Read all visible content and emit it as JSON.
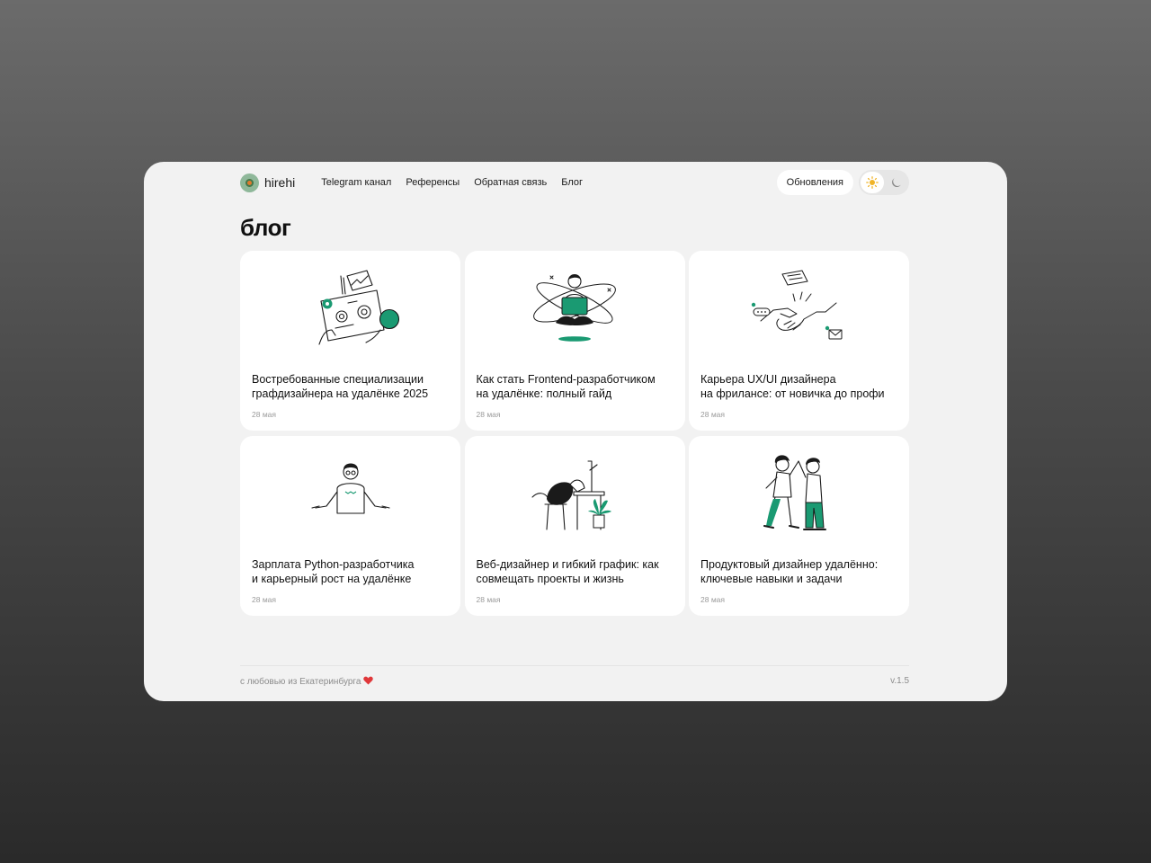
{
  "header": {
    "logo_text": "hirehi",
    "nav": [
      "Telegram канал",
      "Референсы",
      "Обратная связь",
      "Блог"
    ],
    "updates_label": "Обновления",
    "theme": {
      "active": "light",
      "light_icon": "sun-icon",
      "dark_icon": "moon-icon"
    }
  },
  "page": {
    "title": "блог"
  },
  "cards": [
    {
      "title": "Востребованные специализации\nграфдизайнера на удалёнке 2025",
      "date": "28 мая",
      "illustration": "designer-desk-illustration"
    },
    {
      "title": "Как стать Frontend-разработчиком\nна удалёнке: полный гайд",
      "date": "28 мая",
      "illustration": "developer-laptop-illustration"
    },
    {
      "title": "Карьера UX/UI дизайнера\nна фрилансе: от новичка до профи",
      "date": "28 мая",
      "illustration": "handshake-illustration"
    },
    {
      "title": "Зарплата Python-разработчика\nи карьерный рост на удалёнке",
      "date": "28 мая",
      "illustration": "shrugging-man-illustration"
    },
    {
      "title": "Веб-дизайнер и гибкий график: как\nсовмещать проекты и жизнь",
      "date": "28 мая",
      "illustration": "tired-worker-illustration"
    },
    {
      "title": "Продуктовый дизайнер удалённо:\nключевые навыки и задачи",
      "date": "28 мая",
      "illustration": "high-five-illustration"
    }
  ],
  "footer": {
    "left": "с любовью из Екатеринбурга",
    "heart_icon": "heart-icon",
    "version": "v.1.5"
  },
  "colors": {
    "accent": "#1a9a72",
    "background": "#f2f2f2",
    "card": "#ffffff",
    "text": "#111111",
    "muted": "#9a9a9a"
  }
}
